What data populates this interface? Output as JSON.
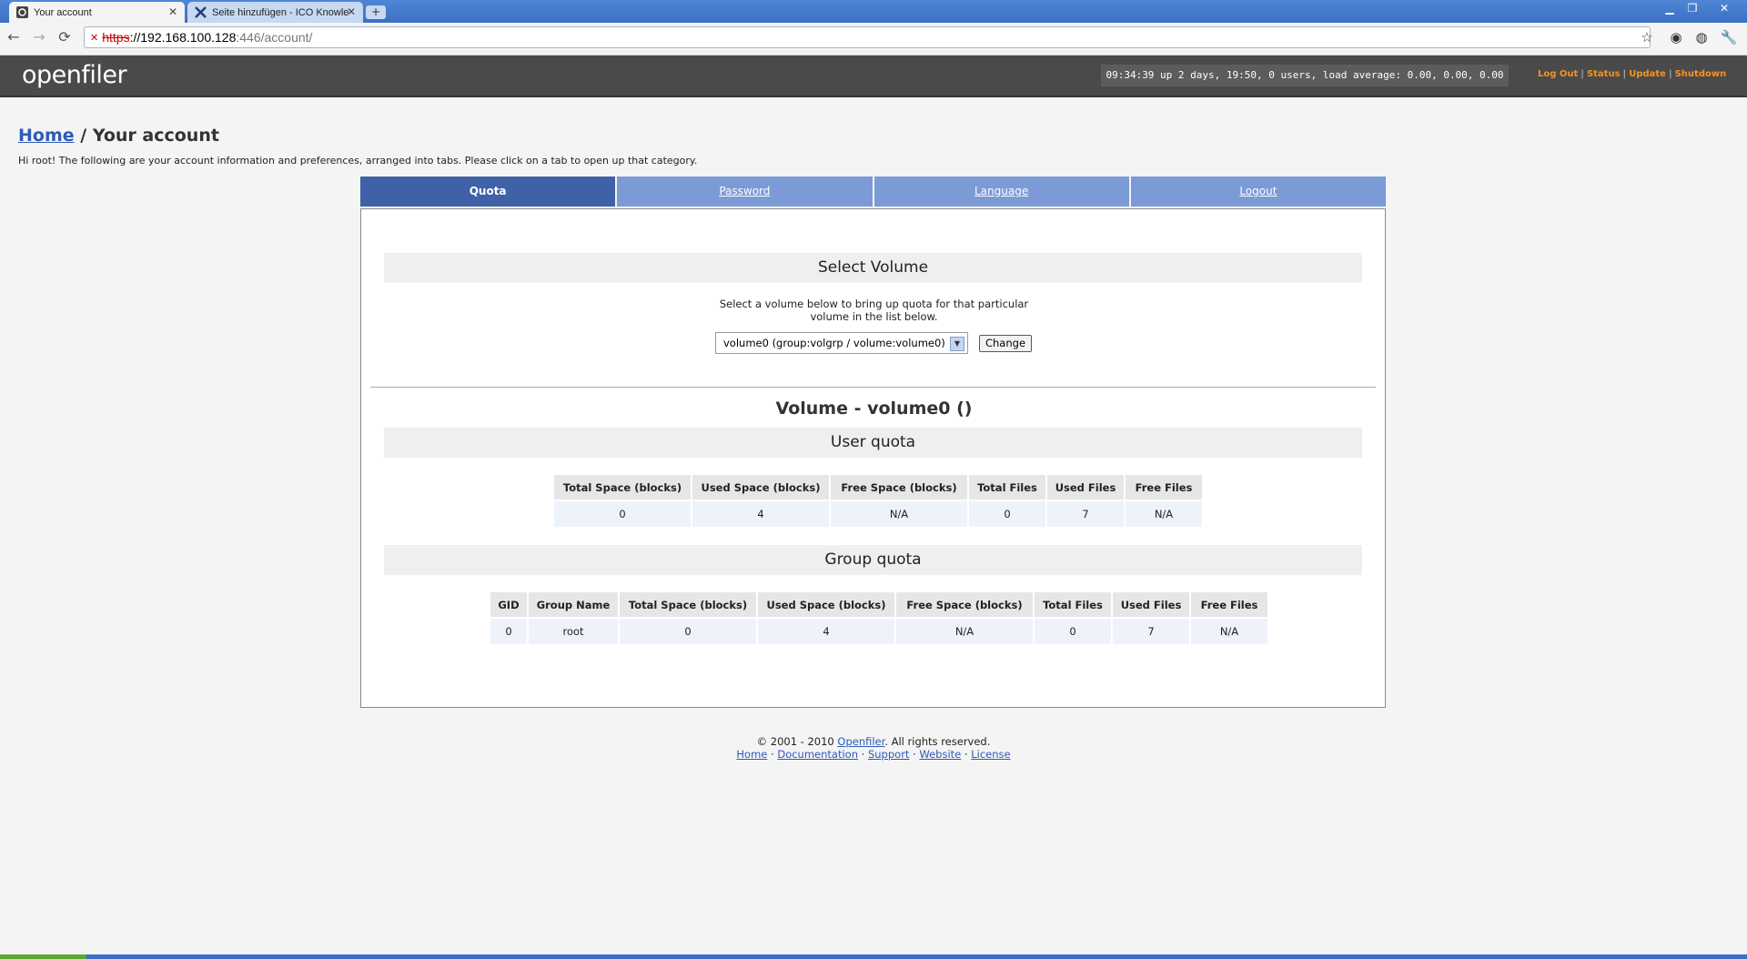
{
  "browser": {
    "tabs": [
      {
        "title": "Your account",
        "icon": "openfiler-icon"
      },
      {
        "title": "Seite hinzufügen - ICO Knowle",
        "icon": "x-icon"
      }
    ],
    "new_tab": "+",
    "url": {
      "proto": "https",
      "host": "://192.168.100.128",
      "path": ":446/account/"
    }
  },
  "header": {
    "logo": "openfiler",
    "uptime": "09:34:39 up 2 days, 19:50, 0 users, load average: 0.00, 0.00, 0.00",
    "links": [
      "Log Out",
      "Status",
      "Update",
      "Shutdown"
    ]
  },
  "page": {
    "breadcrumb_home": "Home",
    "breadcrumb_sep": " / ",
    "breadcrumb_current": "Your account",
    "intro": "Hi root! The following are your account information and preferences, arranged into tabs. Please click on a tab to open up that category."
  },
  "tabs": [
    {
      "label": "Quota",
      "active": true
    },
    {
      "label": "Password",
      "active": false
    },
    {
      "label": "Language",
      "active": false
    },
    {
      "label": "Logout",
      "active": false
    }
  ],
  "select_volume": {
    "heading": "Select Volume",
    "desc_line1": "Select a volume below to bring up quota for that particular",
    "desc_line2": "volume in the list below.",
    "selected": "volume0 (group:volgrp / volume:volume0)",
    "button": "Change"
  },
  "volume_title": "Volume - volume0 ()",
  "user_quota": {
    "heading": "User quota",
    "columns": [
      "Total Space (blocks)",
      "Used Space (blocks)",
      "Free Space (blocks)",
      "Total Files",
      "Used Files",
      "Free Files"
    ],
    "row": [
      "0",
      "4",
      "N/A",
      "0",
      "7",
      "N/A"
    ]
  },
  "group_quota": {
    "heading": "Group quota",
    "columns": [
      "GID",
      "Group Name",
      "Total Space (blocks)",
      "Used Space (blocks)",
      "Free Space (blocks)",
      "Total Files",
      "Used Files",
      "Free Files"
    ],
    "row": [
      "0",
      "root",
      "0",
      "4",
      "N/A",
      "0",
      "7",
      "N/A"
    ]
  },
  "footer": {
    "copyright_pre": "© 2001 - 2010 ",
    "openfiler_link": "Openfiler",
    "copyright_post": ". All rights reserved.",
    "links": [
      "Home",
      "Documentation",
      "Support",
      "Website",
      "License"
    ],
    "sep": " · "
  },
  "colors": {
    "accent": "#3f61a8",
    "tab_inactive": "#7b9ad6",
    "header_link": "#f7931e"
  }
}
